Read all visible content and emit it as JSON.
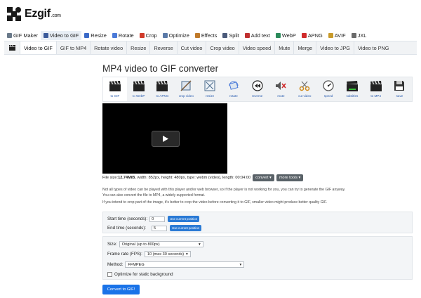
{
  "logo": {
    "name": "Ezgif",
    "suffix": ".com"
  },
  "main_nav": [
    {
      "label": "GIF Maker",
      "icon": "gif-maker-icon",
      "color": "#6a7a8a"
    },
    {
      "label": "Video to GIF",
      "icon": "video-to-gif-icon",
      "color": "#3a5a9a"
    },
    {
      "label": "Resize",
      "icon": "resize-icon",
      "color": "#3a6ac8"
    },
    {
      "label": "Rotate",
      "icon": "rotate-icon",
      "color": "#4a7ad8"
    },
    {
      "label": "Crop",
      "icon": "crop-icon",
      "color": "#d03a2a"
    },
    {
      "label": "Optimize",
      "icon": "optimize-icon",
      "color": "#5a7aa8"
    },
    {
      "label": "Effects",
      "icon": "effects-icon",
      "color": "#c07a2a"
    },
    {
      "label": "Split",
      "icon": "split-icon",
      "color": "#4a5a7a"
    },
    {
      "label": "Add text",
      "icon": "add-text-icon",
      "color": "#c03030"
    },
    {
      "label": "WebP",
      "icon": "webp-icon",
      "color": "#2a8a5a"
    },
    {
      "label": "APNG",
      "icon": "apng-icon",
      "color": "#d02a2a"
    },
    {
      "label": "AVIF",
      "icon": "avif-icon",
      "color": "#c89a2a"
    },
    {
      "label": "JXL",
      "icon": "jxl-icon",
      "color": "#6a6a6a"
    }
  ],
  "sub_nav": [
    "Video to GIF",
    "GIF to MP4",
    "Rotate video",
    "Resize",
    "Reverse",
    "Cut video",
    "Crop video",
    "Video speed",
    "Mute",
    "Merge",
    "Video to JPG",
    "Video to PNG"
  ],
  "page_title": "MP4 video to GIF converter",
  "tools": [
    {
      "label": "to GIF",
      "icon": "clapperboard-icon"
    },
    {
      "label": "to WebP",
      "icon": "clapperboard-icon"
    },
    {
      "label": "to APNG",
      "icon": "clapperboard-icon"
    },
    {
      "label": "crop video",
      "icon": "crop-video-icon"
    },
    {
      "label": "resize",
      "icon": "resize-video-icon"
    },
    {
      "label": "rotate",
      "icon": "rotate-video-icon"
    },
    {
      "label": "reverse",
      "icon": "reverse-icon"
    },
    {
      "label": "mute",
      "icon": "mute-icon"
    },
    {
      "label": "cut video",
      "icon": "scissors-icon"
    },
    {
      "label": "speed",
      "icon": "speed-icon"
    },
    {
      "label": "subtitles",
      "icon": "subtitles-icon"
    },
    {
      "label": "to MP4",
      "icon": "clapperboard-icon"
    },
    {
      "label": "save",
      "icon": "save-icon"
    }
  ],
  "file_info": {
    "prefix": "File size: ",
    "size": "12.74MiB",
    "rest": ", width: 852px, height: 480px, type: webm (video), length: 00:04:00",
    "convert_btn": "convert ▾",
    "more_tools_btn": "more tools ▾"
  },
  "notes": [
    "Not all types of video can be played with this player and/or web browser, so if the player is not working for you, you can try to generate the GIF anyway.",
    "You can also convert the file to MP4, a widely supported format.",
    "If you intend to crop part of the image, it's better to crop the video before converting it to GIF, smaller video might produce better quality GIF."
  ],
  "time_panel": {
    "start_label": "Start time (seconds):",
    "start_value": "0",
    "end_label": "End time (seconds):",
    "end_value": "5",
    "use_position": "Use current position"
  },
  "options": {
    "size_label": "Size:",
    "size_value": "Original (up to 800px)",
    "fps_label": "Frame rate (FPS):",
    "fps_value": "10 (max 30 seconds)",
    "method_label": "Method:",
    "method_value": "FFMPEG",
    "optimize_label": "Optimize for static background"
  },
  "convert_button": "Convert to GIF!"
}
